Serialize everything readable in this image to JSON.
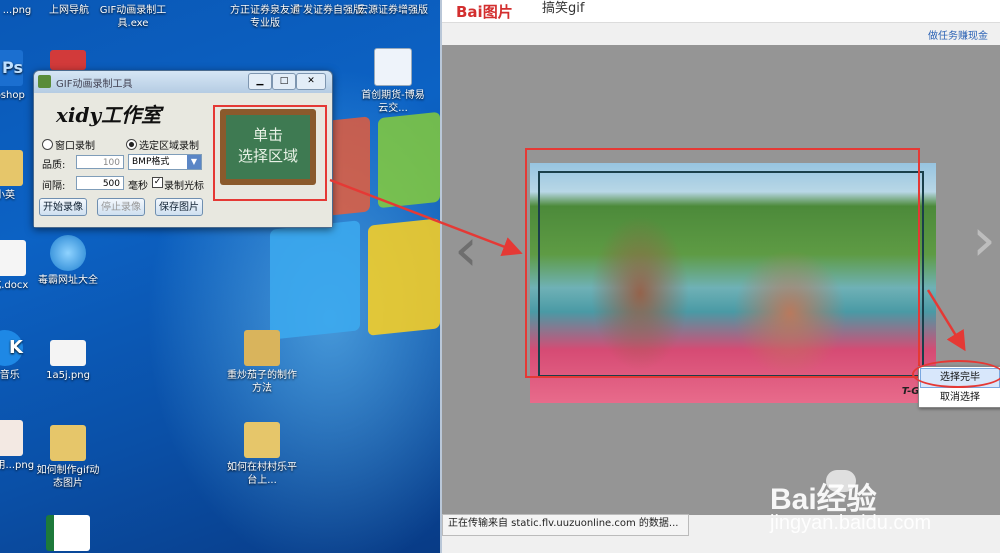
{
  "desktop": {
    "top_labels": [
      "...png",
      "上网导航",
      "GIF动画录制工具.exe",
      "方正证券泉友通专业版",
      "广发证券自强版",
      "宏源证券增强版"
    ],
    "icons": [
      {
        "label": "...oshop",
        "icon": "photoshop-icon"
      },
      {
        "label": "小英",
        "icon": "folder-icon"
      },
      {
        "label": "...成.docx",
        "icon": "word-doc-icon"
      },
      {
        "label": "...音乐",
        "icon": "music-icon"
      },
      {
        "label": "...使用...png",
        "icon": "image-file-icon"
      },
      {
        "label": "首创期货-博易云交...",
        "icon": "app-shortcut-icon"
      },
      {
        "label": "毒霸网址大全",
        "icon": "ie-browser-icon"
      },
      {
        "label": "1a5j.png",
        "icon": "image-file-icon"
      },
      {
        "label": "如何制作gif动态图片",
        "icon": "folder-icon"
      },
      {
        "label": "重炒茄子的制作方法",
        "icon": "folder-icon"
      },
      {
        "label": "如何在村村乐平台上...",
        "icon": "folder-icon"
      }
    ]
  },
  "recorder": {
    "title": "GIF动画录制工具",
    "brand": "xidy工作室",
    "mode_window": "窗口录制",
    "mode_region": "选定区域录制",
    "quality_label": "品质:",
    "quality_value": "100",
    "format_value": "BMP格式",
    "interval_label": "间隔:",
    "interval_value": "500",
    "interval_unit": "毫秒",
    "record_cursor": "录制光标",
    "start_button": "开始录像",
    "stop_button": "停止录像",
    "save_button": "保存图片",
    "board_line1": "单击",
    "board_line2": "选择区域"
  },
  "browser": {
    "logo": "Bai图片",
    "search_text": "搞笑gif",
    "task_link": "做任务赚现金",
    "status_text": "正在传输来自 static.flv.uuzuonline.com 的数据...",
    "watermark": "T-GIF",
    "context_menu": [
      "选择完毕",
      "取消选择"
    ]
  },
  "baidu_watermark": {
    "brand": "Bai经验",
    "url": "jingyan.baidu.com"
  },
  "colors": {
    "annotation_red": "#e53935",
    "desktop_blue": "#0a58b6"
  }
}
